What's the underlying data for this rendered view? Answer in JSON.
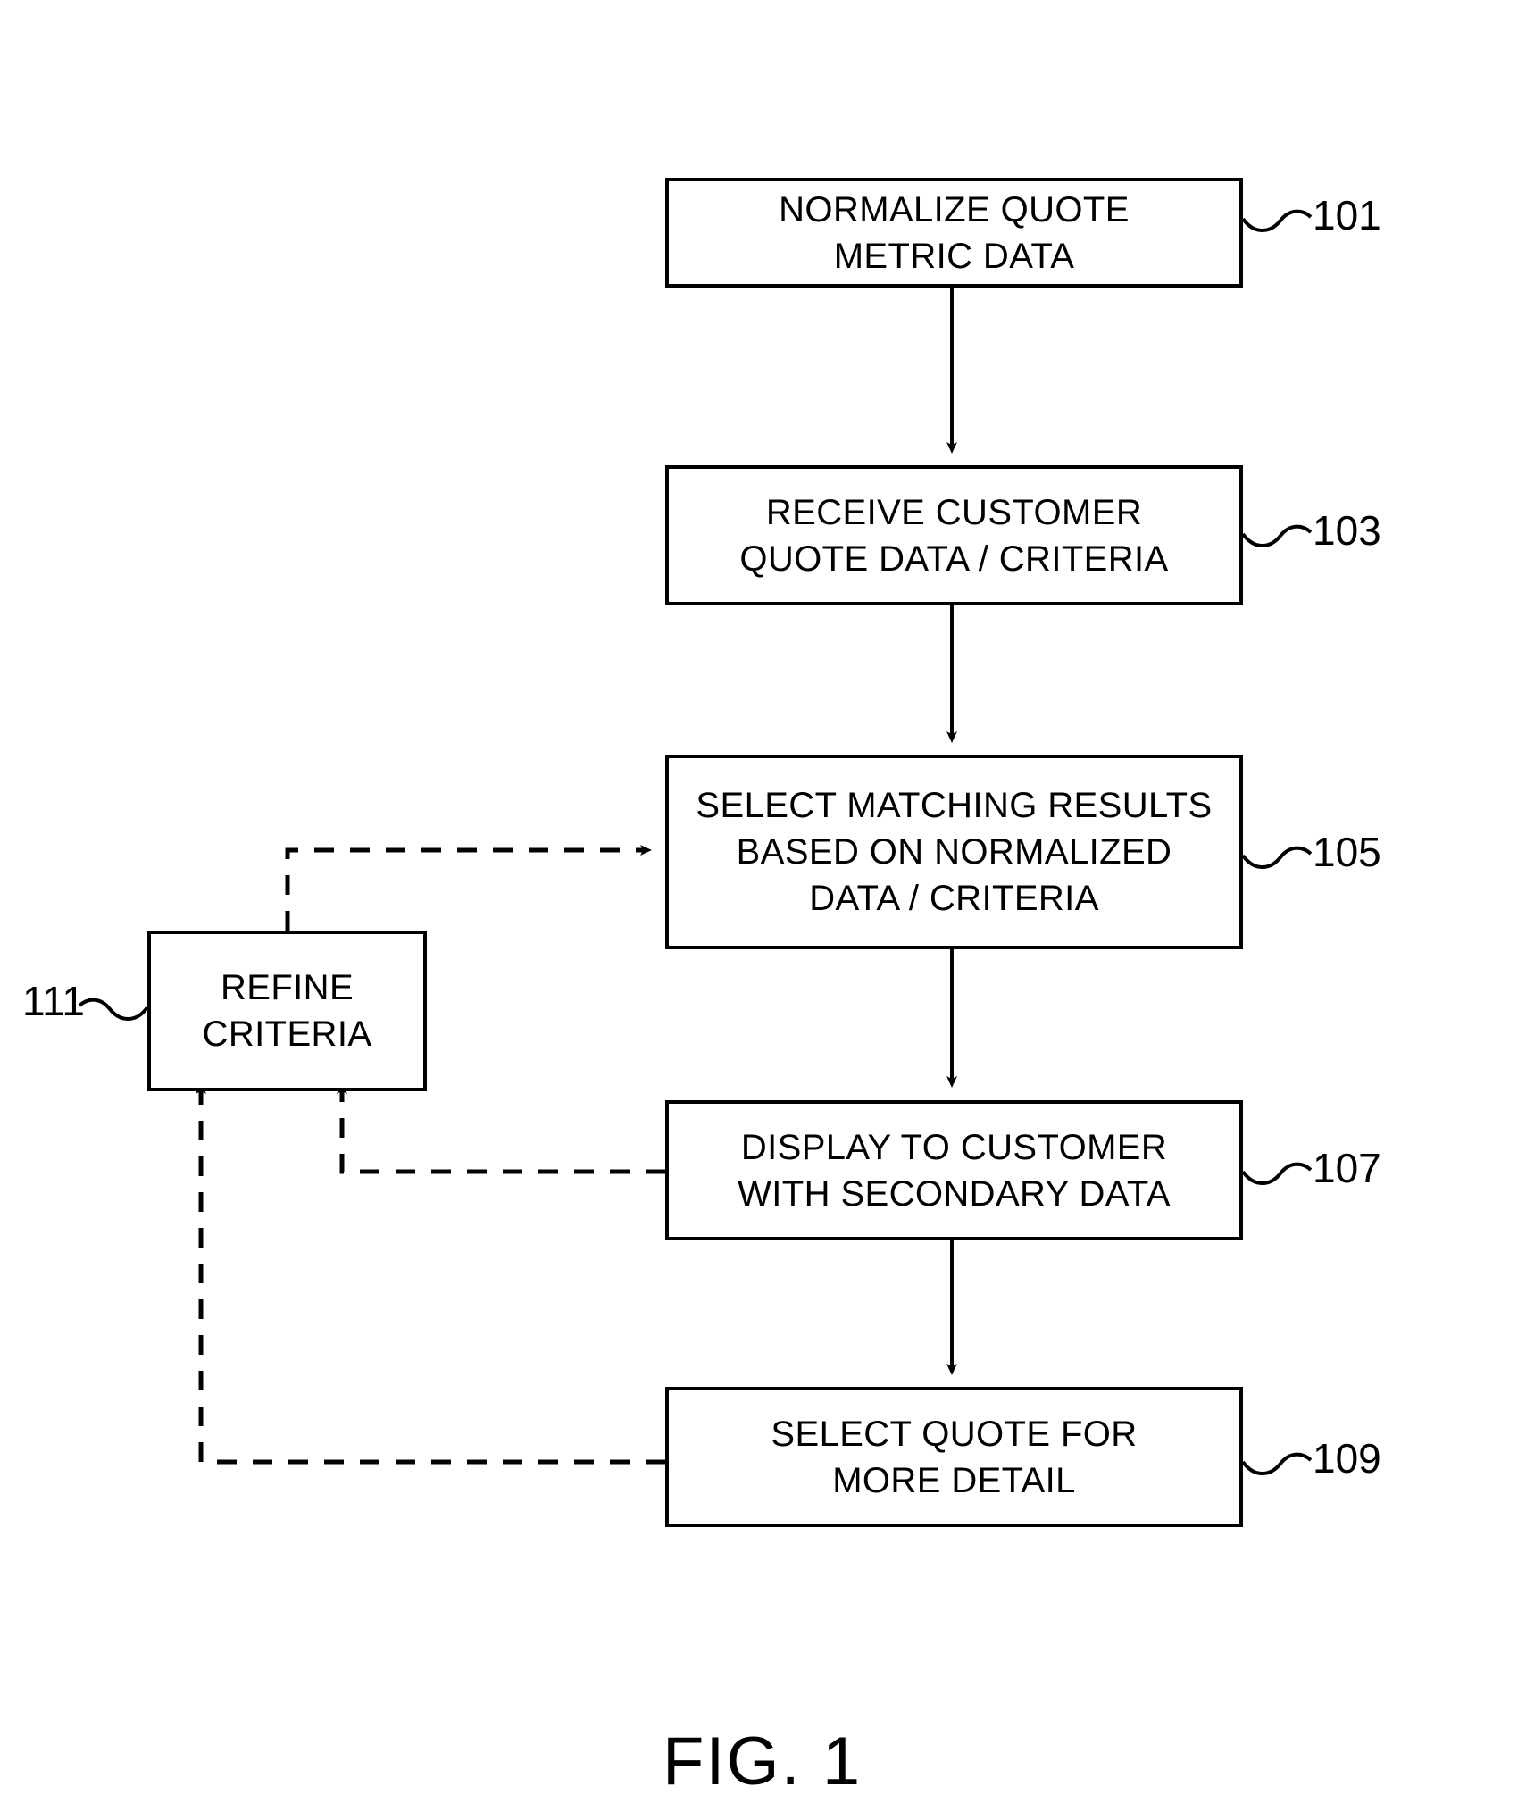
{
  "figure": {
    "caption": "FIG. 1",
    "type": "patent-flowchart"
  },
  "nodes": [
    {
      "id": "normalize-quote-metric-data",
      "ref": "101",
      "lines": [
        "NORMALIZE QUOTE",
        "METRIC DATA"
      ]
    },
    {
      "id": "receive-customer-quote-data",
      "ref": "103",
      "lines": [
        "RECEIVE CUSTOMER",
        "QUOTE DATA / CRITERIA"
      ]
    },
    {
      "id": "select-matching-results",
      "ref": "105",
      "lines": [
        "SELECT MATCHING RESULTS",
        "BASED ON NORMALIZED",
        "DATA / CRITERIA"
      ]
    },
    {
      "id": "refine-criteria",
      "ref": "111",
      "lines": [
        "REFINE",
        "CRITERIA"
      ]
    },
    {
      "id": "display-to-customer",
      "ref": "107",
      "lines": [
        "DISPLAY TO CUSTOMER",
        "WITH SECONDARY DATA"
      ]
    },
    {
      "id": "select-quote-for-more-detail",
      "ref": "109",
      "lines": [
        "SELECT QUOTE FOR",
        "MORE DETAIL"
      ]
    }
  ],
  "connectors": [
    {
      "id": "flow-101-to-103",
      "style": "solid",
      "from": "101",
      "to": "103"
    },
    {
      "id": "flow-103-to-105",
      "style": "solid",
      "from": "103",
      "to": "105"
    },
    {
      "id": "flow-105-to-107",
      "style": "solid",
      "from": "105",
      "to": "107"
    },
    {
      "id": "flow-107-to-109",
      "style": "solid",
      "from": "107",
      "to": "109"
    },
    {
      "id": "feedback-111-to-105",
      "style": "dashed",
      "from": "111",
      "to": "105"
    },
    {
      "id": "feedback-107-to-111",
      "style": "dashed",
      "from": "107",
      "to": "111"
    },
    {
      "id": "feedback-109-to-111",
      "style": "dashed",
      "from": "109",
      "to": "111"
    }
  ],
  "colors": {
    "stroke": "#000000",
    "background": "#ffffff",
    "text": "#000000"
  }
}
